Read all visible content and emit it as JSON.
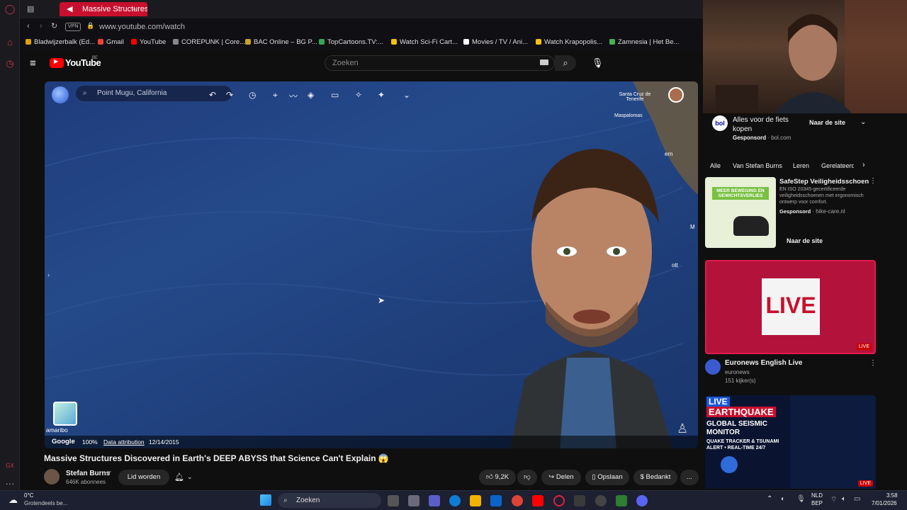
{
  "browser": {
    "tab_title": "Massive Structures Dis",
    "new_tab": "+",
    "url": "www.youtube.com/watch",
    "vpn": "VPN",
    "bookmarks": [
      "Bladwijzerbalk (Ed...",
      "Gmail",
      "YouTube",
      "COREPUNK | Core...",
      "BAC Online – BG P...",
      "TopCartoons.TV:...",
      "Watch Sci-Fi Cart...",
      "Movies / TV / Ani...",
      "Watch Krapopolis...",
      "Zamnesia | Het Be..."
    ]
  },
  "youtube": {
    "logo": "YouTube",
    "region": "BE",
    "search_placeholder": "Zoeken"
  },
  "video": {
    "earth_search": "Point Mugu, California",
    "map_labels": [
      "Santa Cruz de Tenerife",
      "Maspalomas",
      "ern",
      "ott",
      "M"
    ],
    "footer": {
      "brand": "Google",
      "zoom": "100%",
      "attribution": "Data attribution",
      "date": "12/14/2015"
    },
    "layer_label": "amaribo",
    "title": "Massive Structures Discovered in Earth's DEEP ABYSS that Science Can't Explain 😱"
  },
  "channel": {
    "name": "Stefan Burns",
    "subscribers": "646K abonnees",
    "join": "Lid worden"
  },
  "actions": {
    "likes": "9,2K",
    "share": "Delen",
    "save": "Opslaan",
    "thanks": "Bedankt",
    "more": "..."
  },
  "sidebar": {
    "ad1": {
      "title": "Alles voor de fiets kopen",
      "sponsored": "Gesponsord",
      "domain": "bol.com",
      "cta": "Naar de site",
      "logo": "bol"
    },
    "chips": [
      "Alle",
      "Van Stefan Burns",
      "Leren",
      "Gerelateerd"
    ],
    "ad2": {
      "title": "SafeStep Veiligheidsschoen",
      "desc": "EN ISO 20345-gecertificeerde veiligheidsschoenen met ergonomisch ontwerp voor comfort.",
      "sponsored": "Gesponsord",
      "domain": "hike-care.nl",
      "cta": "Naar de site",
      "thumb_heading": "MEER BEWEGING EN GEWICHTSVERLIES"
    },
    "video1": {
      "thumb_text": "LIVE",
      "badge": "LIVE",
      "title": "Euronews English Live",
      "channel": "euronews",
      "viewers": "151 kijker(s)"
    },
    "video2": {
      "line1": "LIVE",
      "line2": "EARTHQUAKE",
      "line3": "GLOBAL SEISMIC MONITOR",
      "line4": "QUAKE TRACKER & TSUNAMI ALERT • REAL-TIME 24/7",
      "badge": "LIVE"
    }
  },
  "taskbar": {
    "weather_temp": "0°C",
    "weather_desc": "Grotendeels be...",
    "search": "Zoeken",
    "lang1": "NLD",
    "lang2": "BEP",
    "time": "3:58",
    "date": "7/01/2026"
  }
}
